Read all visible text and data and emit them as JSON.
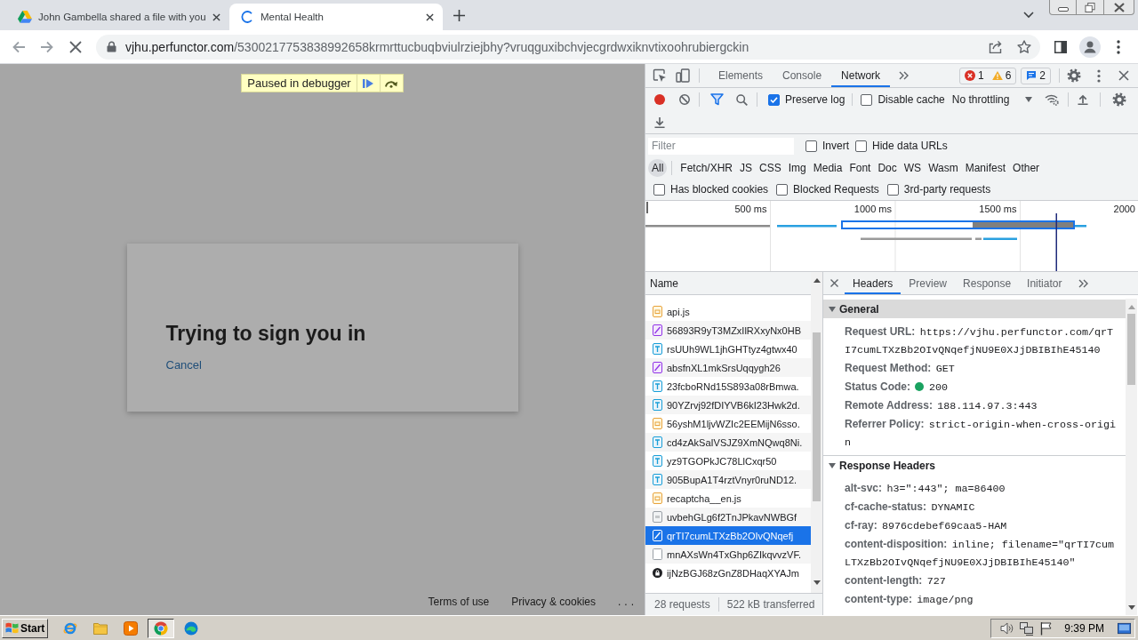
{
  "browser": {
    "tabs": [
      {
        "title": "John Gambella shared a file with you",
        "kind": "drive",
        "selected": false
      },
      {
        "title": "Mental Health",
        "kind": "loading",
        "selected": true
      }
    ],
    "address": {
      "host": "vjhu.perfunctor.com",
      "path": "/5300217753838992658krmrttucbuqbviulrziejbhy?vruqguxibchvjecgrdwxiknvtixoohrubiergckin",
      "loading": true
    }
  },
  "page": {
    "banner": "Paused in debugger",
    "dialog": {
      "title": "Trying to sign you in",
      "link": "Cancel"
    },
    "footer": [
      "Terms of use",
      "Privacy & cookies",
      "..."
    ]
  },
  "devtools": {
    "panels": [
      {
        "label": "Elements",
        "selected": false
      },
      {
        "label": "Console",
        "selected": false
      },
      {
        "label": "Network",
        "selected": true
      }
    ],
    "issues": {
      "errors": "1",
      "warnings": "6",
      "messages": "2"
    },
    "toolbar": {
      "recording": true,
      "options": [
        {
          "label": "Preserve log",
          "checked": true
        },
        {
          "label": "Disable cache",
          "checked": false
        }
      ],
      "throttling": "No throttling"
    },
    "filter": {
      "placeholder": "Filter",
      "options": [
        {
          "label": "Invert",
          "checked": false
        },
        {
          "label": "Hide data URLs",
          "checked": false
        }
      ]
    },
    "types": [
      {
        "label": "All",
        "selected": true
      },
      {
        "label": "Fetch/XHR",
        "selected": false
      },
      {
        "label": "JS",
        "selected": false
      },
      {
        "label": "CSS",
        "selected": false
      },
      {
        "label": "Img",
        "selected": false
      },
      {
        "label": "Media",
        "selected": false
      },
      {
        "label": "Font",
        "selected": false
      },
      {
        "label": "Doc",
        "selected": false
      },
      {
        "label": "WS",
        "selected": false
      },
      {
        "label": "Wasm",
        "selected": false
      },
      {
        "label": "Manifest",
        "selected": false
      },
      {
        "label": "Other",
        "selected": false
      }
    ],
    "extra_filters": [
      {
        "label": "Has blocked cookies",
        "checked": false
      },
      {
        "label": "Blocked Requests",
        "checked": false
      },
      {
        "label": "3rd-party requests",
        "checked": false
      }
    ],
    "overview": {
      "ticks": [
        "500 ms",
        "1000 ms",
        "1500 ms",
        "2000"
      ]
    },
    "requests": {
      "column": "Name",
      "rows": [
        {
          "name": "api.js",
          "kind": "script",
          "selected": false
        },
        {
          "name": "56893R9yT3MZxIlRXxyNx0HB",
          "kind": "image",
          "selected": false
        },
        {
          "name": "rsUUh9WL1jhGHTtyz4gtwx40",
          "kind": "text",
          "selected": false
        },
        {
          "name": "absfnXL1mkSrsUqqygh26",
          "kind": "image",
          "selected": false
        },
        {
          "name": "23fcboRNd15S893a08rBmwa.",
          "kind": "text",
          "selected": false
        },
        {
          "name": "90YZrvj92fDIYVB6kI23Hwk2d.",
          "kind": "text",
          "selected": false
        },
        {
          "name": "56yshM1ljvWZIc2EEMijN6sso.",
          "kind": "script",
          "selected": false
        },
        {
          "name": "cd4zAkSaIVSJZ9XmNQwq8Ni.",
          "kind": "text",
          "selected": false
        },
        {
          "name": "yz9TGOPkJC78LlCxqr50",
          "kind": "text",
          "selected": false
        },
        {
          "name": "905BupA1T4rztVnyr0ruND12.",
          "kind": "text",
          "selected": false
        },
        {
          "name": "recaptcha__en.js",
          "kind": "script",
          "selected": false
        },
        {
          "name": "uvbehGLg6f2TnJPkavNWBGf",
          "kind": "plain",
          "selected": false
        },
        {
          "name": "qrTI7cumLTXzBb2OIvQNqefj",
          "kind": "image",
          "selected": true
        },
        {
          "name": "mnAXsWn4TxGhp6ZIkqvvzVF.",
          "kind": "blank",
          "selected": false
        },
        {
          "name": "ijNzBGJ68zGnZ8DHaqXYAJm",
          "kind": "dark",
          "selected": false
        }
      ],
      "summary": [
        "28 requests",
        "522 kB transferred"
      ]
    },
    "details": {
      "tabs": [
        {
          "label": "Headers",
          "selected": true
        },
        {
          "label": "Preview",
          "selected": false
        },
        {
          "label": "Response",
          "selected": false
        },
        {
          "label": "Initiator",
          "selected": false
        }
      ],
      "sections": [
        {
          "title": "General",
          "expanded": true,
          "selected": true,
          "entries": [
            {
              "name": "Request URL:",
              "value": "https://vjhu.perfunctor.com/qrTI7cumLTXzBb2OIvQNqefjNU9E0XJjDBIBIhE45140"
            },
            {
              "name": "Request Method:",
              "value": "GET"
            },
            {
              "name": "Status Code:",
              "value": "200",
              "color": "#1aa260"
            },
            {
              "name": "Remote Address:",
              "value": "188.114.97.3:443"
            },
            {
              "name": "Referrer Policy:",
              "value": "strict-origin-when-cross-origin"
            }
          ]
        },
        {
          "title": "Response Headers",
          "expanded": true,
          "selected": false,
          "entries": [
            {
              "name": "alt-svc:",
              "value": "h3=\":443\"; ma=86400"
            },
            {
              "name": "cf-cache-status:",
              "value": "DYNAMIC"
            },
            {
              "name": "cf-ray:",
              "value": "8976cdebef69caa5-HAM"
            },
            {
              "name": "content-disposition:",
              "value": "inline; filename=\"qrTI7cumLTXzBb2OIvQNqefjNU9E0XJjDBIBIhE45140\""
            },
            {
              "name": "content-length:",
              "value": "727"
            },
            {
              "name": "content-type:",
              "value": "image/png"
            }
          ]
        }
      ]
    }
  },
  "taskbar": {
    "start": "Start",
    "apps": [
      {
        "kind": "ie",
        "selected": false
      },
      {
        "kind": "folder",
        "selected": false
      },
      {
        "kind": "media",
        "selected": false
      },
      {
        "kind": "chrome",
        "selected": true
      },
      {
        "kind": "edge",
        "selected": false
      }
    ],
    "clock": "9:39 PM"
  }
}
